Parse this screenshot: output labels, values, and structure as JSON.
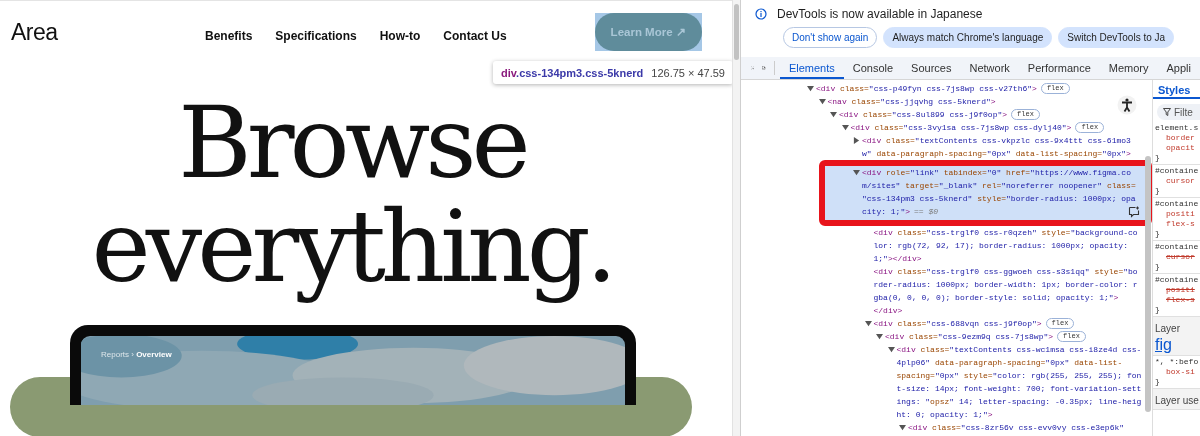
{
  "page": {
    "logo": "Area",
    "nav": [
      "Benefits",
      "Specifications",
      "How-to",
      "Contact Us"
    ],
    "cta": {
      "label": "Learn More ↗",
      "inspected": true
    },
    "inspect_tooltip": {
      "selector": "div.css-134pm3.css-5knerd",
      "size": "126.75 × 47.59"
    },
    "hero": [
      "Browse",
      "everything."
    ],
    "preview": {
      "breadcrumb": "Reports › **Overview**"
    }
  },
  "devtools": {
    "infobar": {
      "message": "DevTools is now available in Japanese",
      "buttons": [
        {
          "label": "Don't show again",
          "kind": "outlined"
        },
        {
          "label": "Always match Chrome's language",
          "kind": "filled"
        },
        {
          "label": "Switch DevTools to Ja",
          "kind": "filled"
        }
      ]
    },
    "tabs": [
      {
        "label": "Elements",
        "selected": true
      },
      {
        "label": "Console",
        "selected": false
      },
      {
        "label": "Sources",
        "selected": false
      },
      {
        "label": "Network",
        "selected": false
      },
      {
        "label": "Performance",
        "selected": false
      },
      {
        "label": "Memory",
        "selected": false
      },
      {
        "label": "Appli",
        "selected": false
      }
    ],
    "dom_tree": [
      {
        "lines": [
          "<div class=\"css-p49fyn css-7js8wp css-v27th6\">"
        ],
        "badge": "flex",
        "expanded": true,
        "selected": false,
        "children": [
          {
            "lines": [
              "<nav class=\"css-jjqvhg css-5knerd\">"
            ],
            "expanded": true,
            "selected": false,
            "children": [
              {
                "lines": [
                  "<div class=\"css-8ul899 css-j9f0op\">"
                ],
                "badge": "flex",
                "expanded": true,
                "selected": false,
                "children": [
                  {
                    "lines": [
                      "<div class=\"css-3vy1sa css-7js8wp css-dylj40\">"
                    ],
                    "badge": "flex",
                    "expanded": true,
                    "selected": false,
                    "children": [
                      {
                        "lines": [
                          "<div class=\"textContents css-vkpzlc css-9x4ttt css-61mo3",
                          "w\" data-paragraph-spacing=\"0px\" data-list-spacing=\"0px\">"
                        ],
                        "expanded": false,
                        "selected": false
                      },
                      {
                        "lines": [
                          "<div role=\"link\" tabindex=\"0\" href=\"https://www.figma.co",
                          "m/sites\" target=\"_blank\" rel=\"noreferrer noopener\" class=",
                          "\"css-134pm3 css-5knerd\" style=\"border-radius: 1000px; opa",
                          "city: 1;\">"
                        ],
                        "suffix": "== $0",
                        "expanded": true,
                        "selected": true,
                        "children": [
                          {
                            "lines": [
                              "<div class=\"css-trglf0 css-r0qzeh\" style=\"background-co",
                              "lor: rgb(72, 92, 17); border-radius: 1000px; opacity:",
                              "1;\"></div>"
                            ],
                            "selected": false
                          },
                          {
                            "lines": [
                              "<div class=\"css-trglf0 css-ggwoeh css-s3s1qq\" style=\"bo",
                              "rder-radius: 1000px; border-width: 1px; border-color: r",
                              "gba(0, 0, 0, 0); border-style: solid; opacity: 1;\">",
                              "</div>"
                            ],
                            "selected": false
                          },
                          {
                            "lines": [
                              "<div class=\"css-688vqn css-j9f0op\">"
                            ],
                            "badge": "flex",
                            "expanded": true,
                            "selected": false,
                            "children": [
                              {
                                "lines": [
                                  "<div class=\"css-9ezm9q css-7js8wp\">"
                                ],
                                "badge": "flex",
                                "expanded": true,
                                "selected": false,
                                "children": [
                                  {
                                    "lines": [
                                      "<div class=\"textContents css-wc1msa css-i8ze4d css-",
                                      "4plp06\" data-paragraph-spacing=\"0px\" data-list-",
                                      "spacing=\"0px\" style=\"color: rgb(255, 255, 255); fon",
                                      "t-size: 14px; font-weight: 700; font-variation-sett",
                                      "ings: \"opsz\" 14; letter-spacing: -0.35px; line-heig",
                                      "ht: 0; opacity: 1;\">"
                                    ],
                                    "expanded": true,
                                    "selected": false,
                                    "children": [
                                      {
                                        "lines": [
                                          "<div class=\"css-8zr56v css-evv0vy css-e3ep6k\""
                                        ],
                                        "expanded": true,
                                        "selected": false
                                      }
                                    ]
                                  }
                                ]
                              }
                            ]
                          }
                        ]
                      }
                    ]
                  }
                ]
              }
            ]
          }
        ]
      }
    ],
    "styles": {
      "tab": "Styles",
      "filter_placeholder": "Filte",
      "blocks": [
        {
          "kind": "rule",
          "selector": "element.s",
          "props": [
            {
              "text": "border",
              "overridden": false
            },
            {
              "text": "opacit",
              "overridden": false
            }
          ],
          "close": "}"
        },
        {
          "kind": "rule",
          "selector": "#containe",
          "props": [
            {
              "text": "cursor",
              "overridden": false
            }
          ],
          "close": "}"
        },
        {
          "kind": "rule",
          "selector": "#containe",
          "props": [
            {
              "text": "positi",
              "overridden": false
            },
            {
              "text": "flex-s",
              "overridden": false
            }
          ],
          "close": "}"
        },
        {
          "kind": "rule",
          "selector": "#containe",
          "props": [
            {
              "text": "cursor",
              "overridden": true
            }
          ],
          "close": "}"
        },
        {
          "kind": "rule",
          "selector": "#containe",
          "props": [
            {
              "text": "positi",
              "overridden": true
            },
            {
              "text": "flex-s",
              "overridden": true
            }
          ],
          "close": "}"
        },
        {
          "kind": "layer",
          "label": "Layer",
          "link": "fig"
        },
        {
          "kind": "rule",
          "selector": "*, *:befo",
          "props": [
            {
              "text": "box-si",
              "overridden": false
            }
          ],
          "close": "}"
        },
        {
          "kind": "layer",
          "label": "Layer use"
        }
      ]
    }
  }
}
